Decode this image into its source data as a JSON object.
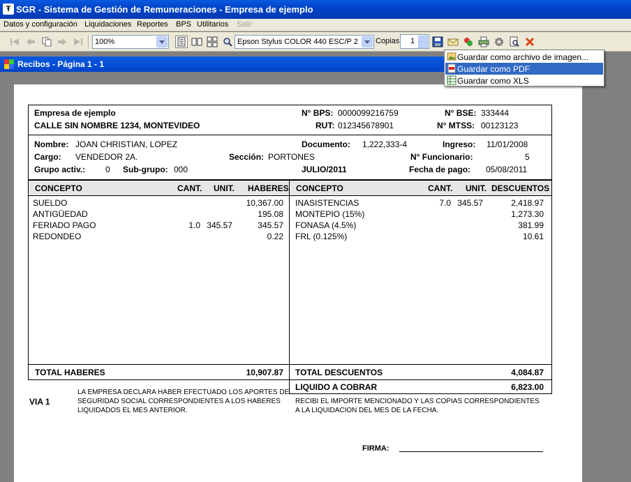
{
  "window": {
    "title": "SGR - Sistema de Gestión de Remuneraciones - Empresa de ejemplo"
  },
  "menu": [
    "Datos y configuración",
    "Liquidaciones",
    "Reportes",
    "BPS",
    "Utilitarios",
    "Salir"
  ],
  "toolbar": {
    "zoom": "100%",
    "printer": "Epson Stylus COLOR 440 ESC/P 2",
    "copias_label": "Copias",
    "copias_value": "1"
  },
  "document_window": {
    "title": "Recibos - Página 1 - 1"
  },
  "save_menu": [
    {
      "label": "Guardar como archivo de imagen...",
      "icon": "image-icon"
    },
    {
      "label": "Guardar como PDF",
      "icon": "pdf-icon",
      "selected": true
    },
    {
      "label": "Guardar como XLS",
      "icon": "xls-icon"
    }
  ],
  "receipt": {
    "company": "Empresa de ejemplo",
    "address": "CALLE SIN NOMBRE 1234, MONTEVIDEO",
    "bps_label": "N° BPS:",
    "bps": "0000099216759",
    "bse_label": "N° BSE:",
    "bse": "333444",
    "rut_label": "RUT:",
    "rut": "012345678901",
    "mtss_label": "N° MTSS:",
    "mtss": "00123123",
    "nombre_label": "Nombre:",
    "nombre": "JOAN CHRISTIAN, LOPEZ",
    "documento_label": "Documento:",
    "documento": "1,222,333-4",
    "ingreso_label": "Ingreso:",
    "ingreso": "11/01/2008",
    "cargo_label": "Cargo:",
    "cargo": "VENDEDOR 2A.",
    "seccion_label": "Sección:",
    "seccion": "PORTONES",
    "funcionario_label": "N° Funcionario:",
    "funcionario": "5",
    "grupo_label": "Grupo activ.:",
    "grupo": "0",
    "subgrupo_label": "Sub-grupo:",
    "subgrupo": "000",
    "periodo": "JULIO/2011",
    "fecha_pago_label": "Fecha de pago:",
    "fecha_pago": "05/08/2011",
    "left_headers": {
      "concepto": "CONCEPTO",
      "cant": "CANT.",
      "unit": "UNIT.",
      "total": "HABERES"
    },
    "right_headers": {
      "concepto": "CONCEPTO",
      "cant": "CANT.",
      "unit": "UNIT.",
      "total": "DESCUENTOS"
    },
    "haberes": [
      {
        "concepto": "SUELDO",
        "cant": "",
        "unit": "",
        "importe": "10,367.00"
      },
      {
        "concepto": "ANTIGÜEDAD",
        "cant": "",
        "unit": "",
        "importe": "195.08"
      },
      {
        "concepto": "FERIADO PAGO",
        "cant": "1.0",
        "unit": "345.57",
        "importe": "345.57"
      },
      {
        "concepto": "REDONDEO",
        "cant": "",
        "unit": "",
        "importe": "0.22"
      }
    ],
    "descuentos": [
      {
        "concepto": "INASISTENCIAS",
        "cant": "7.0",
        "unit": "345.57",
        "importe": "2,418.97"
      },
      {
        "concepto": "MONTEPIO (15%)",
        "cant": "",
        "unit": "",
        "importe": "1,273.30"
      },
      {
        "concepto": "FONASA (4.5%)",
        "cant": "",
        "unit": "",
        "importe": "381.99"
      },
      {
        "concepto": "FRL (0.125%)",
        "cant": "",
        "unit": "",
        "importe": "10.61"
      }
    ],
    "total_haberes_label": "TOTAL HABERES",
    "total_haberes": "10,907.87",
    "total_descuentos_label": "TOTAL DESCUENTOS",
    "total_descuentos": "4,084.87",
    "liquido_label": "LIQUIDO A COBRAR",
    "liquido": "6,823.00",
    "via": "VIA 1",
    "declaracion": [
      "LA EMPRESA DECLARA HABER EFECTUADO LOS APORTES DE",
      "SEGURIDAD SOCIAL CORRESPONDIENTES A LOS HABERES",
      "LIQUIDADOS EL MES ANTERIOR."
    ],
    "recibi": [
      "RECIBI EL IMPORTE MENCIONADO Y LAS COPIAS CORRESPONDIENTES",
      "A LA LIQUIDACION DEL MES DE LA FECHA."
    ],
    "firma_label": "FIRMA:"
  }
}
